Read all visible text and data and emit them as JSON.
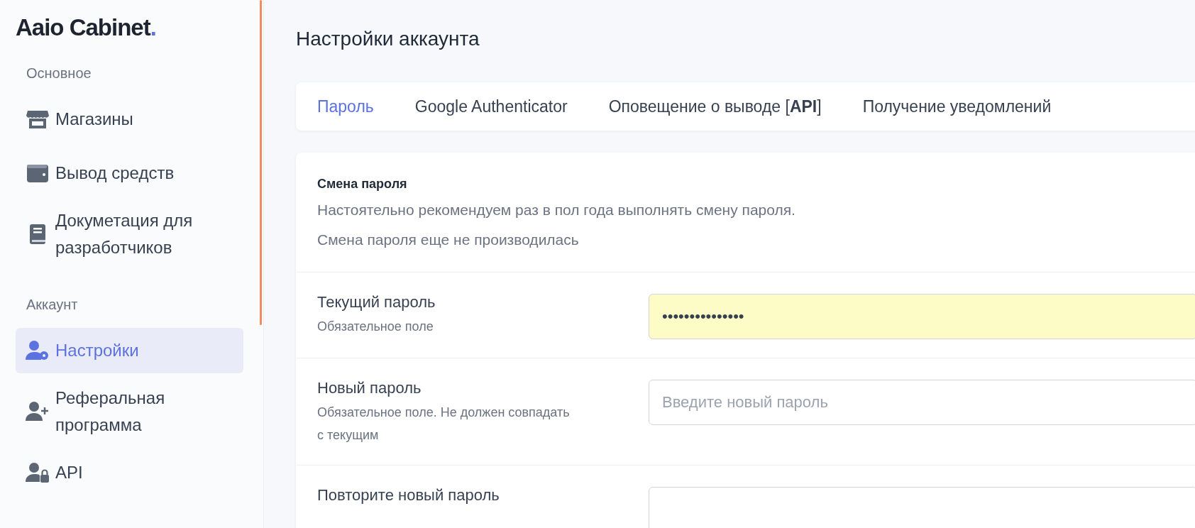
{
  "logo": {
    "text": "Aaio Cabinet",
    "dot": "."
  },
  "sidebar": {
    "sections": [
      {
        "title": "Основное",
        "items": [
          {
            "label": "Магазины",
            "selected": false
          },
          {
            "label": "Вывод средств",
            "selected": false
          },
          {
            "label": "Докуметация для разработчиков",
            "selected": false
          }
        ]
      },
      {
        "title": "Аккаунт",
        "items": [
          {
            "label": "Настройки",
            "selected": true
          },
          {
            "label": "Реферальная программа",
            "selected": false
          },
          {
            "label": "API",
            "selected": false
          }
        ]
      }
    ]
  },
  "page_title": "Настройки аккаунта",
  "tabs": [
    {
      "label": "Пароль",
      "selected": true
    },
    {
      "label": "Google Authenticator",
      "selected": false
    },
    {
      "label": "Оповещение о выводе [**API**]",
      "selected": false
    },
    {
      "label": "Получение уведомлений",
      "selected": false
    }
  ],
  "section": {
    "title": "Смена пароля",
    "description": [
      "Настоятельно рекомендуем раз в пол года выполнять смену пароля.",
      "Смена пароля еще не производилась"
    ]
  },
  "fields": [
    {
      "label": "Текущий пароль",
      "hint": "Обязательное поле",
      "value": "•••••••••••••••",
      "autofilled": true
    },
    {
      "label": "Новый пароль",
      "hint": "Обязательное поле. Не должен совпадать с текущим",
      "placeholder": "Введите новый пароль",
      "autofilled": false
    },
    {
      "label": "Повторите новый пароль",
      "autofilled": false
    }
  ]
}
